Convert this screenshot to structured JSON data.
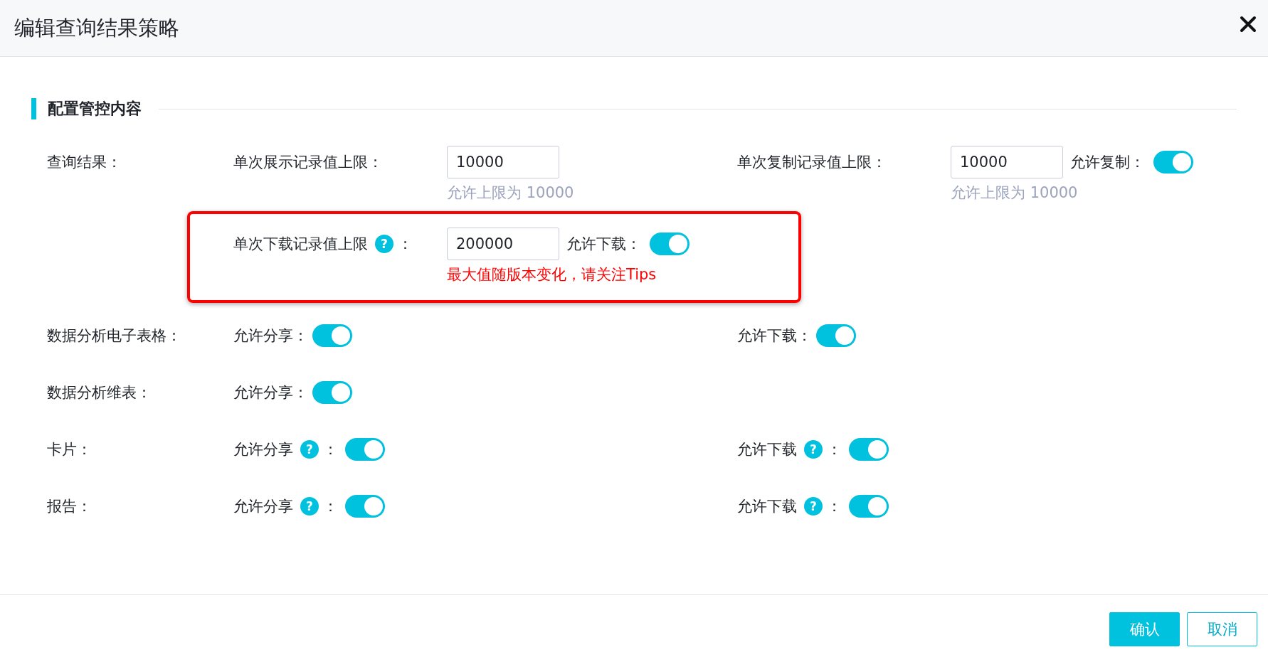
{
  "dialog": {
    "title": "编辑查询结果策略"
  },
  "section": {
    "title": "配置管控内容"
  },
  "rows": [
    {
      "label": "查询结果：",
      "highlighted": false,
      "cells": [
        {
          "kind": "input",
          "label": "单次展示记录值上限：",
          "value": "10000",
          "hint": "允许上限为 10000"
        },
        {
          "kind": "input",
          "label": "单次复制记录值上限：",
          "value": "10000",
          "toggle": {
            "label": "允许复制：",
            "on": true
          },
          "hint": "允许上限为 10000"
        }
      ]
    },
    {
      "highlighted": true,
      "cells": [
        {
          "kind": "input",
          "label": "单次下载记录值上限",
          "help": "?",
          "colon": "：",
          "value": "200000",
          "toggle": {
            "label": "允许下载：",
            "on": true
          },
          "note": "最大值随版本变化，请关注Tips"
        }
      ]
    },
    {
      "label": "数据分析电子表格：",
      "highlighted": false,
      "cells": [
        {
          "kind": "toggle",
          "label": "允许分享：",
          "on": true
        },
        {
          "kind": "toggle",
          "label": "允许下载：",
          "on": true
        }
      ]
    },
    {
      "label": "数据分析维表：",
      "highlighted": false,
      "cells": [
        {
          "kind": "toggle",
          "label": "允许分享：",
          "on": true
        }
      ]
    },
    {
      "label": "卡片：",
      "highlighted": false,
      "cells": [
        {
          "kind": "toggle",
          "label": "允许分享",
          "help": "?",
          "colon": "：",
          "on": true
        },
        {
          "kind": "toggle",
          "label": "允许下载",
          "help": "?",
          "colon": "：",
          "on": true
        }
      ]
    },
    {
      "label": "报告：",
      "highlighted": false,
      "cells": [
        {
          "kind": "toggle",
          "label": "允许分享",
          "help": "?",
          "colon": "：",
          "on": true
        },
        {
          "kind": "toggle",
          "label": "允许下载",
          "help": "?",
          "colon": "：",
          "on": true
        }
      ]
    }
  ],
  "buttons": [
    {
      "label": "确认",
      "kind": "primary"
    },
    {
      "label": "取消",
      "kind": "secondary"
    }
  ]
}
